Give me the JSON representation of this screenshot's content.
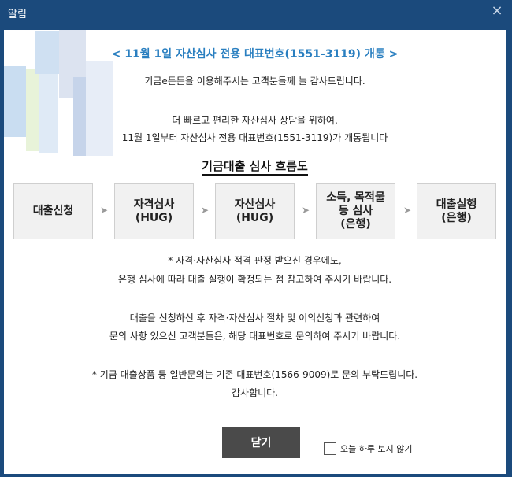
{
  "window": {
    "title": "알림",
    "close_icon": "×"
  },
  "notice": {
    "headline": "< 11월 1일 자산심사 전용 대표번호(1551-3119) 개통 >",
    "greeting": "기금e든든을 이용해주시는 고객분들께 늘 감사드립니다.",
    "intro_line1": "더 빠르고 편리한 자산심사 상담을 위하여,",
    "intro_line2": "11월 1일부터 자산심사 전용 대표번호(1551-3119)가 개통됩니다"
  },
  "flow": {
    "title": "기금대출 심사 흐름도",
    "steps": [
      {
        "line1": "대출신청",
        "line2": "",
        "line3": ""
      },
      {
        "line1": "자격심사",
        "line2": "(HUG)",
        "line3": ""
      },
      {
        "line1": "자산심사",
        "line2": "(HUG)",
        "line3": ""
      },
      {
        "line1": "소득, 목적물",
        "line2": "등 심사",
        "line3": "(은행)"
      },
      {
        "line1": "대출실행",
        "line2": "(은행)",
        "line3": ""
      }
    ],
    "arrow_icon": "➤"
  },
  "notes": {
    "note1_line1": "* 자격·자산심사 적격 판정 받으신 경우에도,",
    "note1_line2": "은행 심사에 따라 대출 실행이 확정되는 점 참고하여 주시기 바랍니다.",
    "note2_line1": "대출을 신청하신 후 자격·자산심사 절차 및 이의신청과 관련하여",
    "note2_line2": "문의 사항 있으신 고객분들은, 해당 대표번호로 문의하여 주시기 바랍니다.",
    "note3_line1": "* 기금 대출상품 등 일반문의는 기존 대표번호(1566-9009)로 문의 부탁드립니다.",
    "note3_line2": "감사합니다."
  },
  "footer": {
    "close_button": "닫기",
    "dont_show_label": "오늘 하루 보지 않기",
    "dont_show_checked": false
  },
  "colors": {
    "titlebar": "#1b4a7c",
    "headline": "#2a7fc0",
    "button": "#4a4a4a"
  }
}
